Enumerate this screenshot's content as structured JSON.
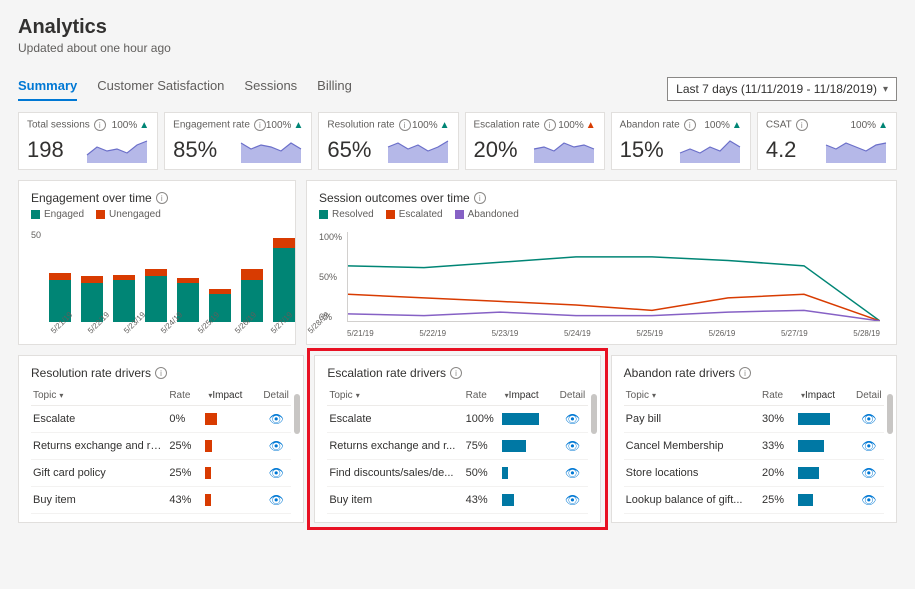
{
  "header": {
    "title": "Analytics",
    "subtitle": "Updated about one hour ago"
  },
  "tabs": [
    "Summary",
    "Customer Satisfaction",
    "Sessions",
    "Billing"
  ],
  "active_tab": 0,
  "date_picker": {
    "label": "Last 7 days (11/11/2019 - 11/18/2019)"
  },
  "kpis": [
    {
      "title": "Total sessions",
      "pct": "100%",
      "trend": "teal",
      "value": "198"
    },
    {
      "title": "Engagement rate",
      "pct": "100%",
      "trend": "teal",
      "value": "85%"
    },
    {
      "title": "Resolution rate",
      "pct": "100%",
      "trend": "teal",
      "value": "65%"
    },
    {
      "title": "Escalation rate",
      "pct": "100%",
      "trend": "orange",
      "value": "20%"
    },
    {
      "title": "Abandon rate",
      "pct": "100%",
      "trend": "teal",
      "value": "15%"
    },
    {
      "title": "CSAT",
      "pct": "100%",
      "trend": "teal",
      "value": "4.2"
    }
  ],
  "engagement": {
    "title": "Engagement over time",
    "legend": [
      "Engaged",
      "Unengaged"
    ],
    "y_max_label": "50"
  },
  "outcomes": {
    "title": "Session outcomes over time",
    "legend": [
      "Resolved",
      "Escalated",
      "Abandoned"
    ],
    "y_labels": [
      "100%",
      "50%",
      "0%"
    ]
  },
  "x_dates": [
    "5/21/19",
    "5/22/19",
    "5/23/19",
    "5/24/19",
    "5/25/19",
    "5/26/19",
    "5/27/19",
    "5/28/19"
  ],
  "drivers_cols": {
    "topic": "Topic",
    "rate": "Rate",
    "impact": "Impact",
    "detail": "Detail"
  },
  "drivers": [
    {
      "title": "Resolution rate drivers",
      "rows": [
        {
          "topic": "Escalate",
          "rate": "0%",
          "impact": 22,
          "color": "orange"
        },
        {
          "topic": "Returns exchange and re...",
          "rate": "25%",
          "impact": 12,
          "color": "orange"
        },
        {
          "topic": "Gift card policy",
          "rate": "25%",
          "impact": 10,
          "color": "orange"
        },
        {
          "topic": "Buy item",
          "rate": "43%",
          "impact": 10,
          "color": "orange"
        }
      ]
    },
    {
      "title": "Escalation rate drivers",
      "rows": [
        {
          "topic": "Escalate",
          "rate": "100%",
          "impact": 70,
          "color": "teal"
        },
        {
          "topic": "Returns exchange and r...",
          "rate": "75%",
          "impact": 46,
          "color": "teal"
        },
        {
          "topic": "Find discounts/sales/de...",
          "rate": "50%",
          "impact": 12,
          "color": "teal"
        },
        {
          "topic": "Buy item",
          "rate": "43%",
          "impact": 22,
          "color": "teal"
        }
      ]
    },
    {
      "title": "Abandon rate drivers",
      "rows": [
        {
          "topic": "Pay bill",
          "rate": "30%",
          "impact": 60,
          "color": "teal"
        },
        {
          "topic": "Cancel Membership",
          "rate": "33%",
          "impact": 48,
          "color": "teal"
        },
        {
          "topic": "Store locations",
          "rate": "20%",
          "impact": 38,
          "color": "teal"
        },
        {
          "topic": "Lookup balance of gift...",
          "rate": "25%",
          "impact": 28,
          "color": "teal"
        }
      ]
    }
  ],
  "chart_data": [
    {
      "type": "bar",
      "title": "Engagement over time",
      "categories": [
        "5/21/19",
        "5/22/19",
        "5/23/19",
        "5/24/19",
        "5/25/19",
        "5/26/19",
        "5/27/19",
        "5/28/19"
      ],
      "series": [
        {
          "name": "Engaged",
          "values": [
            24,
            22,
            24,
            26,
            22,
            16,
            24,
            42
          ]
        },
        {
          "name": "Unengaged",
          "values": [
            4,
            4,
            3,
            4,
            3,
            3,
            6,
            6
          ]
        }
      ],
      "ylim": [
        0,
        50
      ]
    },
    {
      "type": "line",
      "title": "Session outcomes over time",
      "x": [
        "5/21/19",
        "5/22/19",
        "5/23/19",
        "5/24/19",
        "5/25/19",
        "5/26/19",
        "5/27/19",
        "5/28/19"
      ],
      "series": [
        {
          "name": "Resolved",
          "values": [
            62,
            60,
            66,
            72,
            72,
            68,
            62,
            0
          ]
        },
        {
          "name": "Escalated",
          "values": [
            30,
            26,
            22,
            18,
            12,
            26,
            30,
            0
          ]
        },
        {
          "name": "Abandoned",
          "values": [
            8,
            6,
            10,
            6,
            6,
            10,
            12,
            0
          ]
        }
      ],
      "ylabel": "%",
      "ylim": [
        0,
        100
      ]
    }
  ]
}
